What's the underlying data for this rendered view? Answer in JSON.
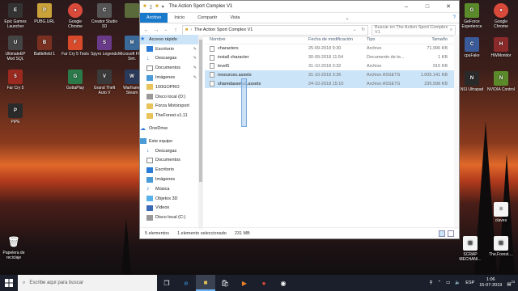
{
  "desktop_icons": {
    "epic": "Epic Games Launcher",
    "pubg": "PUBG.URL",
    "chrome_icon": "Google Chrome",
    "creator": "Creator Studio 3D",
    "blank": "",
    "ultimate": "UltimateEP Mod SQL",
    "battlefield": "Battlefield 1",
    "far_cry_5_shortcut": "Far Cry 5 Tools",
    "spyro": "Spyro Legends",
    "microsoft": "Microsoft Flight Sim.",
    "far_cry_5": "Far Cry 5",
    "gottaplay": "GottaPlay",
    "gta": "Grand Theft Auto V",
    "warframe": "Warframe Steam",
    "pipe": "PiPE",
    "papelera": "Papelera de reciclaje",
    "geforce": "GeForce Experience",
    "google_chrome": "Google Chrome",
    "cpuz": "cpuFake",
    "hwmonitor": "HWMonitor",
    "nsi": "NSI Ultrapad",
    "nvidia": "NVIDIA Control",
    "claves": "claves",
    "scrap": "SCRAP MECHANI...",
    "theforest": "The.Forest...."
  },
  "window": {
    "title": "The Action Sport Complex V1",
    "tabs": [
      "Archivo",
      "Inicio",
      "Compartir",
      "Vista"
    ],
    "path": "The Action Sport Complex V1",
    "search_placeholder": "Buscar en The Action Sport Complex V1"
  },
  "nav": {
    "quick_access": "Acceso rápido",
    "items": [
      "Escritorio",
      "Descargas",
      "Documentos",
      "Imágenes",
      "100GOPRO",
      "Disco local (D:)",
      "Forza Motorsport",
      "TheForest.v1.11"
    ],
    "onedrive": "OneDrive",
    "this_pc": "Este equipo",
    "pc_items": [
      "Descargas",
      "Documentos",
      "Escritorio",
      "Imágenes",
      "Música",
      "Objetos 3D",
      "Vídeos",
      "Disco local (C:)"
    ]
  },
  "columns": [
    "Nombre",
    "Fecha de modificación",
    "Tipo",
    "Tamaño"
  ],
  "files": [
    {
      "name": "characters",
      "date": "25-09-2018 9:30",
      "type": "Archivo",
      "size": "71.996 KB"
    },
    {
      "name": "install character",
      "date": "30-09-2018 11:54",
      "type": "Documento de te...",
      "size": "1 KB"
    },
    {
      "name": "level5",
      "date": "31-10-2018 3:32",
      "type": "Archivo",
      "size": "915 KB"
    },
    {
      "name": "resources.assets",
      "date": "31-10-2018 3:36",
      "type": "Archivo ASSETS",
      "size": "1.005.141 KB"
    },
    {
      "name": "sharedassets2.assets",
      "date": "24-10-2018 15:10",
      "type": "Archivo ASSETS",
      "size": "236.598 KB"
    }
  ],
  "status": {
    "count": "5 elementos",
    "selected": "1 elemento seleccionado",
    "size": "231 MB"
  },
  "taskbar": {
    "search_placeholder": "Escribe aquí para buscar",
    "language": "ESP",
    "time": "1:06",
    "date": "15-07-2019",
    "notif_count": "23"
  },
  "colors": {
    "accent": "#1979ca",
    "selection": "#cce4f7",
    "taskbar": "#1a1f2b"
  }
}
